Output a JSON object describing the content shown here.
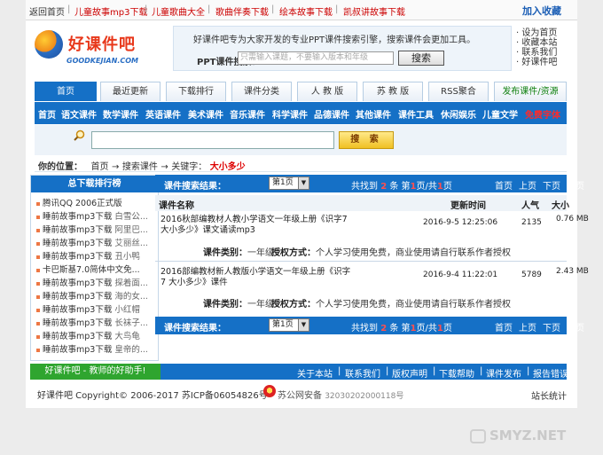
{
  "topbar": {
    "home": "返回首页",
    "links": [
      "儿童故事mp3下载",
      "儿童歌曲大全",
      "歌曲伴奏下载",
      "绘本故事下载",
      "凯叔讲故事下载"
    ],
    "favorite": "加入收藏"
  },
  "logo": {
    "name_cn": "好课件吧",
    "name_en": "GOODKEJIAN.COM"
  },
  "header_search": {
    "description": "好课件吧专为大家开发的专业PPT课件搜索引擎，搜索课件会更加工具。",
    "label": "PPT课件搜索：",
    "placeholder": "只需输入课题，不要输入版本和年级",
    "button": "搜索"
  },
  "quick_links": [
    "设为首页",
    "收藏本站",
    "联系我们",
    "好课件吧"
  ],
  "tabs": [
    "首页",
    "最近更新",
    "下载排行",
    "课件分类",
    "人 教 版",
    "苏 教 版",
    "RSS聚合",
    "发布课件/资源"
  ],
  "nav": [
    "首页",
    "语文课件",
    "数学课件",
    "英语课件",
    "美术课件",
    "音乐课件",
    "科学课件",
    "品德课件",
    "其他课件",
    "课件工具",
    "休闲娱乐",
    "儿童文学",
    "免费字体"
  ],
  "search_row": {
    "button": "搜 索"
  },
  "breadcrumb": {
    "label": "你的位置：",
    "home": "首页",
    "arrow": "→",
    "search": "搜索课件",
    "keyword_label": "关键字：",
    "keyword": "大小多少"
  },
  "sidebar": {
    "title": "总下载排行榜",
    "items": [
      {
        "a": "腾讯QQ 2006正式版",
        "b": ""
      },
      {
        "a": "睡前故事mp3下载",
        "b": "白雪公..."
      },
      {
        "a": "睡前故事mp3下载",
        "b": "阿里巴..."
      },
      {
        "a": "睡前故事mp3下载",
        "b": "艾丽丝..."
      },
      {
        "a": "睡前故事mp3下载",
        "b": "丑小鸭"
      },
      {
        "a": "卡巴斯基7.0简体中文免...",
        "b": ""
      },
      {
        "a": "睡前故事mp3下载",
        "b": "探着面..."
      },
      {
        "a": "睡前故事mp3下载",
        "b": "海的女..."
      },
      {
        "a": "睡前故事mp3下载",
        "b": "小红帽"
      },
      {
        "a": "睡前故事mp3下载",
        "b": "长袜子..."
      },
      {
        "a": "睡前故事mp3下载",
        "b": "大鸟龟"
      },
      {
        "a": "睡前故事mp3下载",
        "b": "皇帝的..."
      }
    ]
  },
  "results": {
    "title": "课件搜索结果：",
    "page_select": "第1页",
    "stats_found": "共找到",
    "stats_count": "2",
    "stats_unit": "条",
    "stats_page_pre": "第",
    "stats_page": "1",
    "stats_page_mid": "页/共",
    "stats_total": "1",
    "stats_page_post": "页",
    "pager": [
      "首页",
      "上页",
      "下页",
      "尾页"
    ],
    "columns": {
      "name": "课件名称",
      "time": "更新时间",
      "popularity": "人气",
      "size": "大小"
    },
    "rows": [
      {
        "title": "2016秋部编教材人教小学语文一年级上册《识字7 大小多少》课文诵读mp3",
        "time": "2016-9-5 12:25:06",
        "popularity": "2135",
        "size": "0.76 MB",
        "category_label": "课件类别：",
        "category": "一年级",
        "license_label": "授权方式：",
        "license": "个人学习使用免费，商业使用请自行联系作者授权"
      },
      {
        "title": "2016部编教材新人教版小学语文一年级上册《识字7 大小多少》课件",
        "time": "2016-9-4 11:22:01",
        "popularity": "5789",
        "size": "2.43 MB",
        "category_label": "课件类别：",
        "category": "一年级",
        "license_label": "授权方式：",
        "license": "个人学习使用免费，商业使用请自行联系作者授权"
      }
    ]
  },
  "footer": {
    "slogan": "好课件吧 - 教师的好助手!",
    "links": [
      "关于本站",
      "联系我们",
      "版权声明",
      "下载帮助",
      "课件发布",
      "报告错误"
    ],
    "copyright": "好课件吧 Copyright© 2006-2017 苏ICP备06054826号",
    "police": "苏公网安备",
    "police_no": "32030202000118号",
    "stats": "站长统计"
  },
  "watermark": "SMYZ.NET"
}
